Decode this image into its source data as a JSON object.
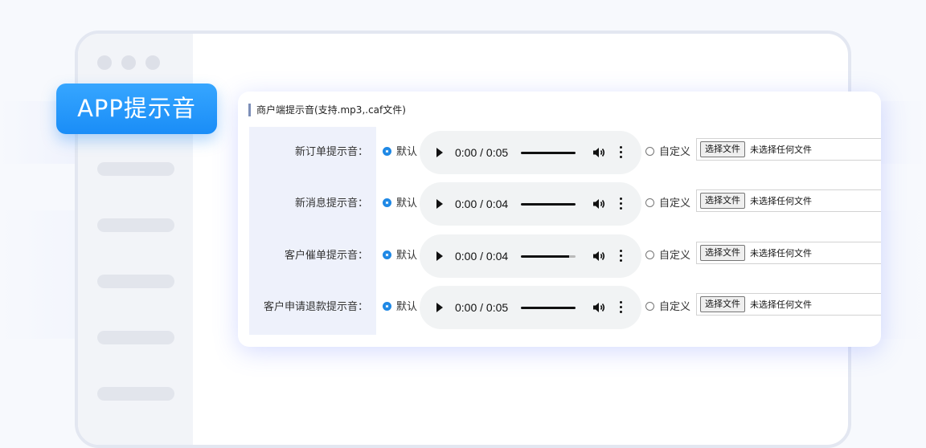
{
  "badge": {
    "label": "APP提示音"
  },
  "card": {
    "title": "商户端提示音(支持.mp3,.caf文件)",
    "rows": [
      {
        "label": "新订单提示音：",
        "default_label": "默认",
        "custom_label": "自定义",
        "time": "0:00 / 0:05",
        "progress": 1.0,
        "file_button": "选择文件",
        "file_status": "未选择任何文件"
      },
      {
        "label": "新消息提示音：",
        "default_label": "默认",
        "custom_label": "自定义",
        "time": "0:00 / 0:04",
        "progress": 1.0,
        "file_button": "选择文件",
        "file_status": "未选择任何文件"
      },
      {
        "label": "客户催单提示音：",
        "default_label": "默认",
        "custom_label": "自定义",
        "time": "0:00 / 0:04",
        "progress": 0.88,
        "file_button": "选择文件",
        "file_status": "未选择任何文件"
      },
      {
        "label": "客户申请退款提示音：",
        "default_label": "默认",
        "custom_label": "自定义",
        "time": "0:00 / 0:05",
        "progress": 1.0,
        "file_button": "选择文件",
        "file_status": "未选择任何文件"
      }
    ]
  },
  "colors": {
    "accent": "#1e88e5",
    "badge": "#1a8df7",
    "label_bg": "#eef1fb"
  },
  "icons": [
    "play-icon",
    "volume-icon",
    "more-vertical-icon"
  ]
}
